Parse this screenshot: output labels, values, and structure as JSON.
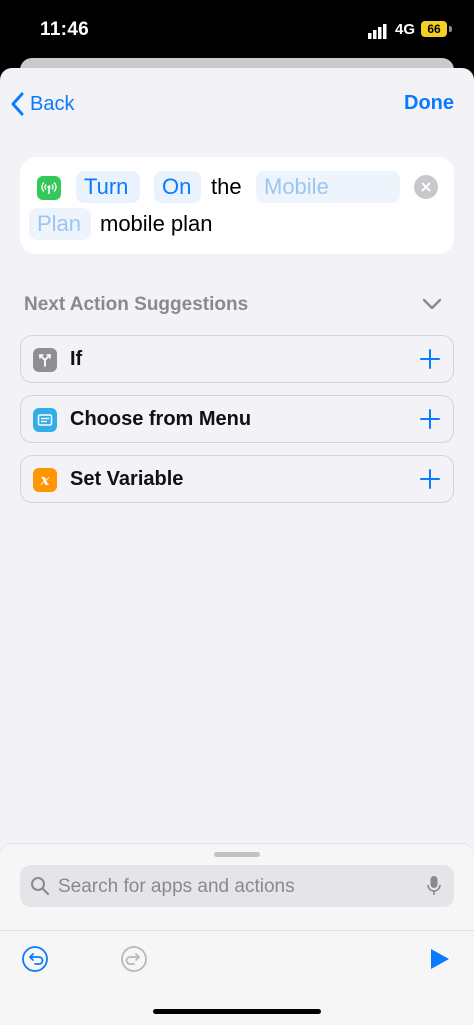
{
  "status_bar": {
    "time": "11:46",
    "network": "4G",
    "battery": "66"
  },
  "nav": {
    "back_label": "Back",
    "done_label": "Done"
  },
  "action": {
    "icon": "antenna-icon",
    "token_1": "Turn",
    "token_2": "On",
    "word_1": "the",
    "placeholder_part1": "Mobile",
    "placeholder_part2": "Plan",
    "word_2": "mobile plan"
  },
  "suggestions": {
    "title": "Next Action Suggestions",
    "items": [
      {
        "label": "If",
        "icon": "branch-icon",
        "color": "#8e8e93"
      },
      {
        "label": "Choose from Menu",
        "icon": "menu-icon",
        "color": "#32ade6"
      },
      {
        "label": "Set Variable",
        "icon": "variable-icon",
        "color": "#ff9500"
      }
    ]
  },
  "search": {
    "placeholder": "Search for apps and actions"
  },
  "colors": {
    "accent": "#0a7bff",
    "sheet_bg": "#f2f2f7"
  }
}
